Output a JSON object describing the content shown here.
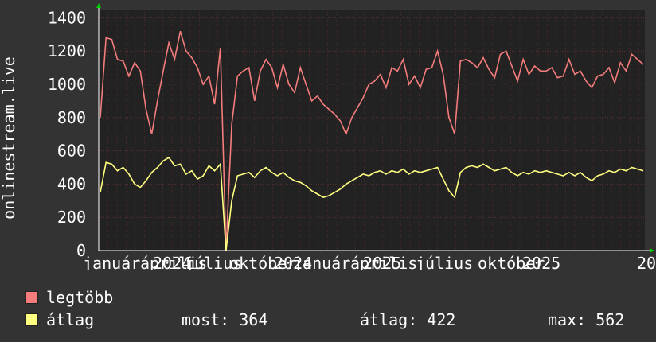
{
  "chart_data": {
    "type": "line",
    "ylabel": "onlinestream.live",
    "ylim": [
      0,
      1450
    ],
    "yticks": [
      "0",
      "200",
      "400",
      "600",
      "800",
      "1000",
      "1200",
      "1400"
    ],
    "ytick_values": [
      0,
      200,
      400,
      600,
      800,
      1000,
      1200,
      1400
    ],
    "xtick_labels": [
      "január",
      "április",
      "2024",
      "július",
      "október",
      "2024",
      "január",
      "április",
      "2025",
      "július",
      "október",
      "2025",
      "20"
    ],
    "series": [
      {
        "name": "legtöbb",
        "color": "#f47c7c",
        "values": [
          800,
          1280,
          1270,
          1150,
          1140,
          1050,
          1130,
          1080,
          850,
          700,
          900,
          1080,
          1250,
          1150,
          1320,
          1200,
          1160,
          1100,
          1000,
          1050,
          880,
          1220,
          0,
          760,
          1050,
          1080,
          1100,
          900,
          1080,
          1150,
          1100,
          980,
          1120,
          1000,
          950,
          1100,
          1000,
          900,
          930,
          880,
          850,
          820,
          780,
          700,
          800,
          860,
          920,
          1000,
          1020,
          1060,
          980,
          1100,
          1080,
          1150,
          1000,
          1050,
          980,
          1090,
          1100,
          1200,
          1060,
          800,
          700,
          1140,
          1150,
          1130,
          1100,
          1160,
          1090,
          1040,
          1180,
          1200,
          1110,
          1020,
          1150,
          1060,
          1110,
          1080,
          1080,
          1100,
          1040,
          1050,
          1150,
          1060,
          1080,
          1020,
          980,
          1050,
          1060,
          1100,
          1010,
          1130,
          1080,
          1180,
          1150,
          1120
        ]
      },
      {
        "name": "átlag",
        "color": "#ffff80",
        "values": [
          350,
          530,
          520,
          480,
          500,
          460,
          400,
          380,
          420,
          470,
          500,
          540,
          560,
          510,
          520,
          460,
          480,
          430,
          450,
          510,
          480,
          520,
          0,
          300,
          450,
          460,
          470,
          440,
          480,
          500,
          470,
          450,
          470,
          440,
          420,
          410,
          390,
          360,
          340,
          320,
          330,
          350,
          370,
          400,
          420,
          440,
          460,
          450,
          470,
          480,
          460,
          480,
          470,
          490,
          460,
          480,
          470,
          480,
          490,
          500,
          430,
          360,
          320,
          470,
          500,
          510,
          500,
          520,
          500,
          480,
          490,
          500,
          470,
          450,
          470,
          460,
          480,
          470,
          480,
          470,
          460,
          450,
          470,
          450,
          470,
          440,
          420,
          450,
          460,
          480,
          470,
          490,
          480,
          500,
          490,
          480
        ]
      }
    ],
    "grid": true
  },
  "legend": {
    "max_label": "legtöbb",
    "avg_label": "átlag",
    "now_text": "most: 364",
    "avg_text": "átlag: 422",
    "max_text": "max: 562"
  }
}
